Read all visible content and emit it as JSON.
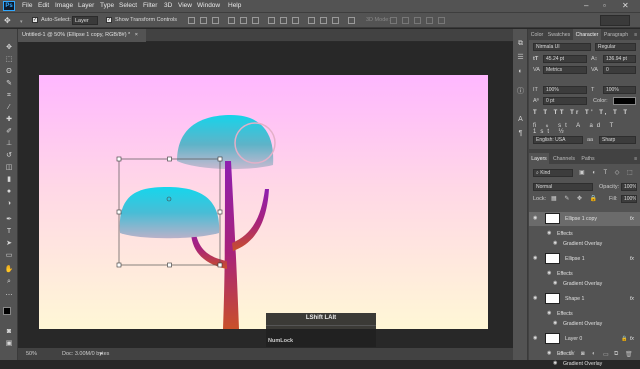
{
  "app": {
    "logo": "Ps"
  },
  "menu": [
    "File",
    "Edit",
    "Image",
    "Layer",
    "Type",
    "Select",
    "Filter",
    "3D",
    "View",
    "Window",
    "Help"
  ],
  "window_controls": [
    "–",
    "▫",
    "✕"
  ],
  "options_bar": {
    "auto_select_label": "Auto-Select:",
    "auto_select_value": "Layer",
    "show_transform_label": "Show Transform Controls",
    "mode_3d_label": "3D Mode:"
  },
  "document": {
    "tab_title": "Untitled-1 @ 50% (Ellipse 1 copy, RGB/8#) *",
    "close_icon": "×"
  },
  "status": {
    "zoom": "50%",
    "doc_info": "Doc: 3.00M/0 bytes"
  },
  "key_overlay": {
    "line1": "LShift  LAlt",
    "line2": "NumLock"
  },
  "panels": {
    "top_tabs": [
      "Color",
      "Swatches",
      "Character",
      "Paragraph"
    ],
    "top_active": "Character",
    "character": {
      "font_family": "Nirmala UI",
      "font_style": "Regular",
      "font_size": "45.24 pt",
      "leading": "136.94 pt",
      "kerning": "Metrics",
      "tracking": "0",
      "vscale": "100%",
      "hscale": "100%",
      "baseline": "0 pt",
      "color_label": "Color:",
      "language": "English: USA",
      "antialias_mark": "aa",
      "antialias": "Sharp"
    },
    "layers_tabs": [
      "Layers",
      "Channels",
      "Paths"
    ],
    "layers_active": "Layers",
    "filter_kind": "Kind",
    "blend_mode": "Normal",
    "opacity_label": "Opacity:",
    "opacity": "100%",
    "lock_label": "Lock:",
    "fill_label": "Fill:",
    "fill": "100%",
    "layers": [
      {
        "type": "layer",
        "name": "Ellipse 1 copy",
        "fx": "fx",
        "selected": true
      },
      {
        "type": "sub",
        "name": "Effects"
      },
      {
        "type": "sub2",
        "name": "Gradient Overlay"
      },
      {
        "type": "layer",
        "name": "Ellipse 1",
        "fx": "fx"
      },
      {
        "type": "sub",
        "name": "Effects"
      },
      {
        "type": "sub2",
        "name": "Gradient Overlay"
      },
      {
        "type": "layer",
        "name": "Shape 1",
        "fx": "fx"
      },
      {
        "type": "sub",
        "name": "Effects"
      },
      {
        "type": "sub2",
        "name": "Gradient Overlay"
      },
      {
        "type": "layer",
        "name": "Layer 0",
        "fx": "fx",
        "locked": true
      },
      {
        "type": "sub",
        "name": "Effects"
      },
      {
        "type": "sub2",
        "name": "Gradient Overlay"
      }
    ],
    "bottom_icons": [
      "link-icon",
      "fx-icon",
      "mask-icon",
      "adjustment-icon",
      "group-icon",
      "new-layer-icon",
      "trash-icon"
    ]
  },
  "colors": {
    "ui_bg": "#535353",
    "accent": "#31a8ff",
    "selected_layer": "#6b6b6b"
  }
}
